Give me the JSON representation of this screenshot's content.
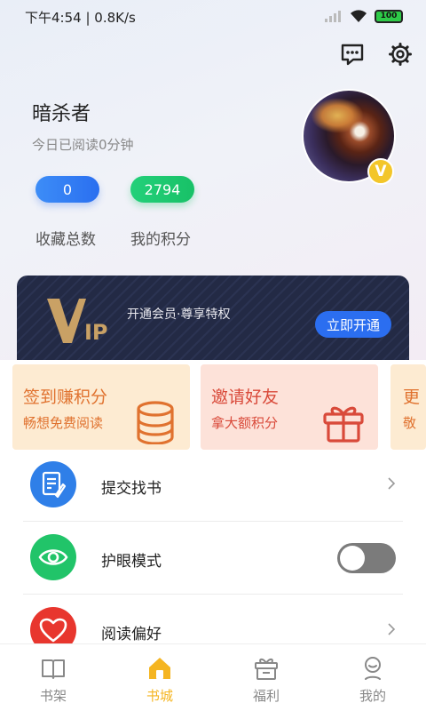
{
  "status_bar": {
    "time": "下午4:54",
    "speed": "0.8K/s",
    "battery": "100"
  },
  "profile": {
    "username": "暗杀者",
    "read_today": "今日已阅读0分钟",
    "favorites_count": "0",
    "points": "2794",
    "favorites_label": "收藏总数",
    "points_label": "我的积分",
    "vip_badge": "V"
  },
  "vip": {
    "logo_text": "VIP",
    "slogan": "开通会员·尊享特权",
    "button": "立即开通"
  },
  "promos": [
    {
      "title": "签到赚积分",
      "subtitle": "畅想免费阅读"
    },
    {
      "title": "邀请好友",
      "subtitle": "拿大额积分"
    },
    {
      "title": "更",
      "subtitle": "敬"
    }
  ],
  "menu": [
    {
      "label": "提交找书",
      "icon": "book-submit-icon"
    },
    {
      "label": "护眼模式",
      "icon": "eye-icon",
      "toggle_on": false
    },
    {
      "label": "阅读偏好",
      "icon": "heart-icon"
    }
  ],
  "tabs": [
    {
      "label": "书架",
      "icon": "bookshelf-icon"
    },
    {
      "label": "书城",
      "icon": "bookstore-icon",
      "active": true
    },
    {
      "label": "福利",
      "icon": "gift-icon"
    },
    {
      "label": "我的",
      "icon": "profile-icon"
    }
  ],
  "colors": {
    "accent": "#f5b521",
    "blue": "#2f7fe8",
    "green": "#21c469",
    "red": "#e8362e"
  }
}
